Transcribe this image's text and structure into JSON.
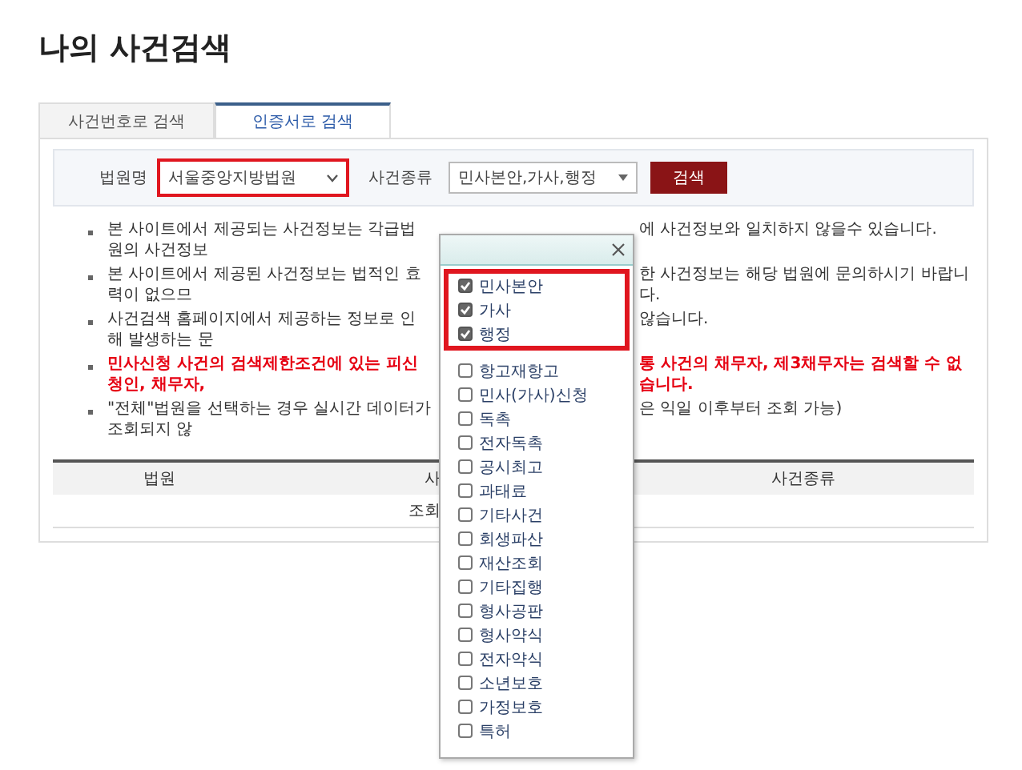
{
  "page_title": "나의 사건검색",
  "tabs": [
    {
      "label": "사건번호로 검색",
      "selected": false
    },
    {
      "label": "인증서로 검색",
      "selected": true
    }
  ],
  "search": {
    "court_label": "법원명",
    "court": {
      "value": "서울중앙지방법원",
      "highlighted": true
    },
    "case_type_label": "사건종류",
    "case_type": {
      "value": "민사본안,가사,행정"
    },
    "search_button": "검색"
  },
  "notices": [
    {
      "kind": "normal",
      "left": "본 사이트에서 제공되는 사건정보는 각급법원의 사건정보",
      "right": "에 사건정보와 일치하지 않을수 있습니다."
    },
    {
      "kind": "normal",
      "left": "본 사이트에서 제공된 사건정보는 법적인 효력이 없으므",
      "right": "한 사건정보는 해당 법원에 문의하시기 바랍니다."
    },
    {
      "kind": "normal",
      "left": "사건검색 홈페이지에서 제공하는 정보로 인해 발생하는 문",
      "right": "않습니다."
    },
    {
      "kind": "warning",
      "left": "민사신청 사건의 검색제한조건에 있는 피신청인, 채무자,",
      "right": "통 사건의 채무자, 제3채무자는 검색할 수 없습니다."
    },
    {
      "kind": "normal",
      "left": "\"전체\"법원을 선택하는 경우 실시간 데이터가 조회되지 않",
      "right": "은 익일 이후부터 조회 가능)"
    }
  ],
  "results_table": {
    "columns": [
      "법원",
      "사",
      "사건종류"
    ],
    "empty_message": "조회"
  },
  "case_type_popup": {
    "groups": [
      {
        "highlighted": true,
        "items": [
          {
            "label": "민사본안",
            "checked": true
          },
          {
            "label": "가사",
            "checked": true
          },
          {
            "label": "행정",
            "checked": true
          }
        ]
      },
      {
        "highlighted": false,
        "items": [
          {
            "label": "항고재항고",
            "checked": false
          },
          {
            "label": "민사(가사)신청",
            "checked": false
          },
          {
            "label": "독촉",
            "checked": false
          },
          {
            "label": "전자독촉",
            "checked": false
          },
          {
            "label": "공시최고",
            "checked": false
          },
          {
            "label": "과태료",
            "checked": false
          },
          {
            "label": "기타사건",
            "checked": false
          },
          {
            "label": "회생파산",
            "checked": false
          },
          {
            "label": "재산조회",
            "checked": false
          },
          {
            "label": "기타집행",
            "checked": false
          },
          {
            "label": "형사공판",
            "checked": false
          },
          {
            "label": "형사약식",
            "checked": false
          },
          {
            "label": "전자약식",
            "checked": false
          },
          {
            "label": "소년보호",
            "checked": false
          },
          {
            "label": "가정보호",
            "checked": false
          },
          {
            "label": "특허",
            "checked": false
          }
        ]
      }
    ]
  }
}
